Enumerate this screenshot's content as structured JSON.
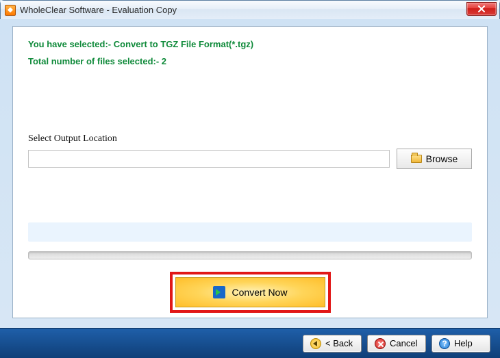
{
  "window": {
    "title": "WholeClear Software - Evaluation Copy"
  },
  "status": {
    "selected_format": "You have selected:- Convert to TGZ File Format(*.tgz)",
    "file_count": "Total number of files selected:- 2"
  },
  "output": {
    "label": "Select Output Location",
    "path_value": "",
    "browse_label": "Browse"
  },
  "actions": {
    "convert_label": "Convert Now"
  },
  "footer": {
    "back_label": "< Back",
    "cancel_label": "Cancel",
    "help_label": "Help"
  }
}
